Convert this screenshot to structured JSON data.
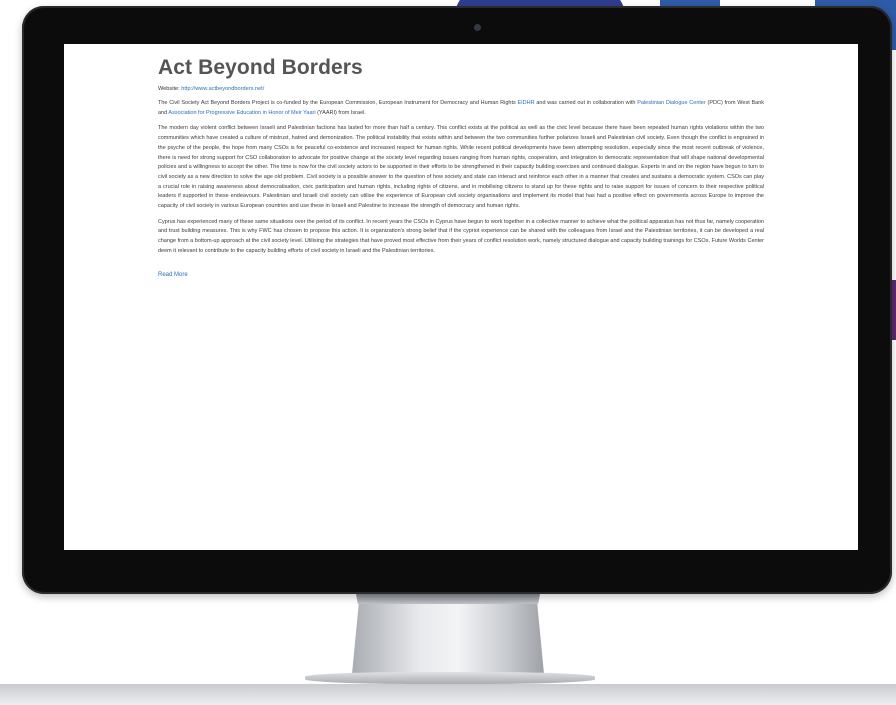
{
  "page": {
    "title": "Act Beyond Borders",
    "website_label": "Website:",
    "website_url": "http://www.actbeyondborders.net/",
    "intro": {
      "part1": "The Civil Society Act Beyond Borders Project is co-funded by the European Commission, European Instrument for Democracy and Human Rights ",
      "eidhr_link": "EIDHR",
      "part2": " and was carried out in collaboration with ",
      "pdc_link": "Palestinian Dialogue Center",
      "part3": " (PDC) from West Bank and ",
      "yaari_link": "Association for Progressive Education in Honor of Meir Yaari",
      "part4": " (YAARI) from Israel."
    },
    "paragraph2": "The modern day violent conflict between Israeli and Palestinian factions has lasted for more than half a century. This conflict exists at the political as well as the civic level because there have been repeated human rights violations within the two communities which have created a culture of mistrust, hatred and demonization. The political instability that exists within and between the two communities further polarizes Israeli and Palestinian civil society. Even though the conflict is engrained in the psyche of the people, the hope from many CSOs is for peaceful co-existence and increased respect for human rights. While recent political developments have been attempting resolution, especially since the most recent outbreak of violence, there is need for strong support for CSO collaboration to advocate for positive change at the society level regarding issues ranging from human rights, cooperation, and integration to democratic representation that will shape national developmental policies and a willingness to accept the other. The time is now for the civil society actors to be supported in their efforts to be strengthened in their capacity building exercises and continued dialogue. Experts in and on the region have begun to turn to civil society as a new direction to solve the age old problem. Civil society is a possible answer to the question of how society and state can interact and reinforce each other in a manner that creates and sustains a democratic system. CSOs can play a crucial role in raising awareness about democratisation, civic participation and human rights, including rights of citizens, and in mobilising citizens to stand up for these rights and to raise support for issues of concern to their respective political leaders if supported in these endeavours. Palestinian and Israeli civil society can utilise the experience of European civil society organisations and implement its model that has had a positive effect on governments across Europe to improve the capacity of civil society in various European countries and use these in Israeli and Palestine to increase the strength of democracy and human rights.",
    "paragraph3": "Cyprus has experienced many of these same situations over the period of its conflict. In recent years the CSOs in Cyprus have begun to work together in a collective manner to achieve what the political apparatus has not thus far, namely cooperation and trust building measures. This is why FWC has chosen to propose this action. It is organization's strong belief that if the cypriot experience can be shared with the colleagues from Israel and the Palestinian territories, it can be developed a real change from a bottom-up approach at the civil society level. Utilising the strategies that have proved most effective from their years of conflict resolution work, namely structured dialogue and capacity building trainings for CSOs, Future Worlds Center deem it relevant to contribute to the capacity building efforts of civil society in Israeli and the Palestinian territories.",
    "read_more": "Read More"
  },
  "colors": {
    "bezel": "#0c0c0c",
    "link": "#2a6fb8",
    "title": "#555555",
    "bg_blue": "#2e5aa8",
    "bg_navy": "#2f3d8f",
    "bg_purple": "#5b2a6e"
  }
}
